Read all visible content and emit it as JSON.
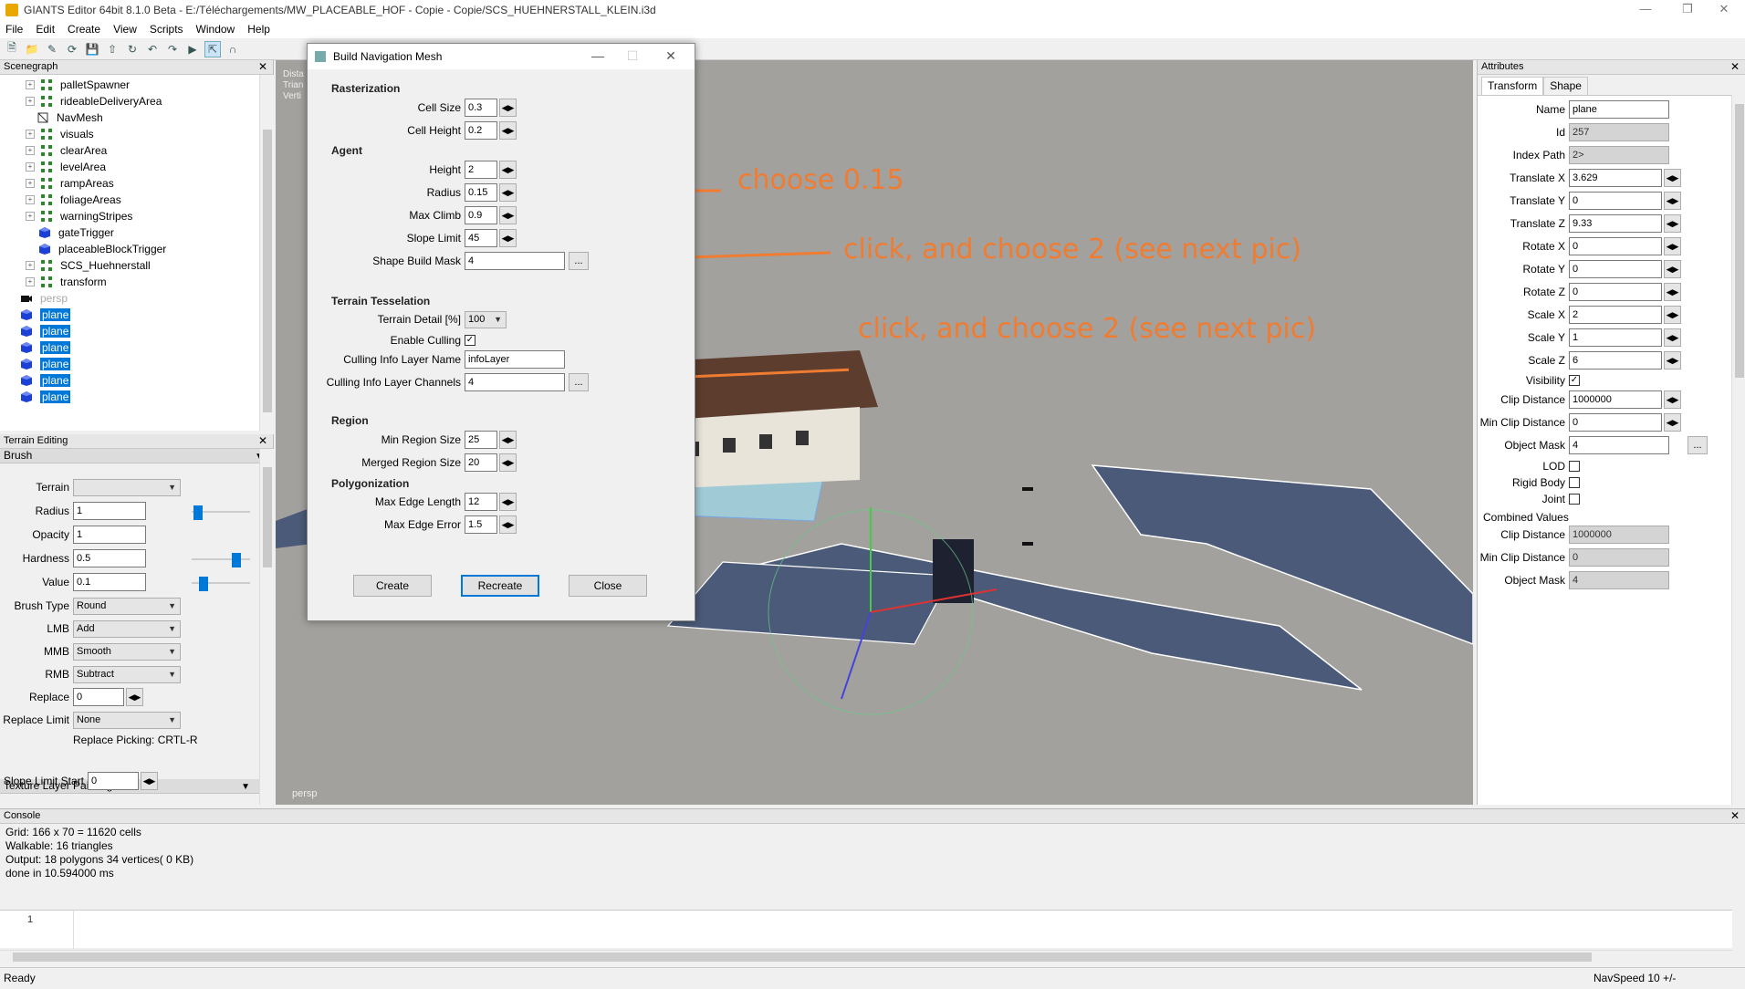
{
  "window": {
    "title": "GIANTS Editor 64bit 8.1.0 Beta - E:/Téléchargements/MW_PLACEABLE_HOF - Copie - Copie/SCS_HUEHNERSTALL_KLEIN.i3d"
  },
  "menu": [
    "File",
    "Edit",
    "Create",
    "View",
    "Scripts",
    "Window",
    "Help"
  ],
  "scenegraph": {
    "title": "Scenegraph",
    "nodes": [
      {
        "label": "palletSpawner",
        "kind": "group"
      },
      {
        "label": "rideableDeliveryArea",
        "kind": "group"
      },
      {
        "label": "NavMesh",
        "kind": "navmesh"
      },
      {
        "label": "visuals",
        "kind": "group"
      },
      {
        "label": "clearArea",
        "kind": "group"
      },
      {
        "label": "levelArea",
        "kind": "group"
      },
      {
        "label": "rampAreas",
        "kind": "group"
      },
      {
        "label": "foliageAreas",
        "kind": "group"
      },
      {
        "label": "warningStripes",
        "kind": "group"
      },
      {
        "label": "gateTrigger",
        "kind": "cube"
      },
      {
        "label": "placeableBlockTrigger",
        "kind": "cube"
      },
      {
        "label": "SCS_Huehnerstall",
        "kind": "group"
      },
      {
        "label": "transform",
        "kind": "group"
      },
      {
        "label": "persp",
        "kind": "camera"
      },
      {
        "label": "plane",
        "kind": "cube"
      },
      {
        "label": "plane",
        "kind": "cube"
      },
      {
        "label": "plane",
        "kind": "cube"
      },
      {
        "label": "plane",
        "kind": "cube"
      },
      {
        "label": "plane",
        "kind": "cube"
      },
      {
        "label": "plane",
        "kind": "cube"
      }
    ]
  },
  "terrain_editing": {
    "title": "Terrain Editing",
    "brush_section": "Brush",
    "terrain_label": "Terrain",
    "terrain_value": "",
    "radius_label": "Radius",
    "radius_value": "1",
    "opacity_label": "Opacity",
    "opacity_value": "1",
    "hardness_label": "Hardness",
    "hardness_value": "0.5",
    "value_label": "Value",
    "value_value": "0.1",
    "brush_type_label": "Brush Type",
    "brush_type_value": "Round",
    "lmb_label": "LMB",
    "lmb_value": "Add",
    "mmb_label": "MMB",
    "mmb_value": "Smooth",
    "rmb_label": "RMB",
    "rmb_value": "Subtract",
    "replace_label": "Replace",
    "replace_value": "0",
    "replace_limit_label": "Replace Limit",
    "replace_limit_value": "None",
    "replace_picking": "Replace Picking: CRTL-R",
    "texture_section": "Texture Layer Painting",
    "slope_limit_start_label": "Slope Limit Start",
    "slope_limit_start_value": "0"
  },
  "viewport": {
    "overlay_lines": [
      "Dista",
      "Trian",
      "Verti"
    ],
    "camera_label": "persp"
  },
  "dialog": {
    "title": "Build Navigation Mesh",
    "rasterization": "Rasterization",
    "cell_size_label": "Cell Size",
    "cell_size": "0.3",
    "cell_height_label": "Cell Height",
    "cell_height": "0.2",
    "agent": "Agent",
    "height_label": "Height",
    "height": "2",
    "radius_label": "Radius",
    "radius": "0.15",
    "max_climb_label": "Max Climb",
    "max_climb": "0.9",
    "slope_limit_label": "Slope Limit",
    "slope_limit": "45",
    "shape_build_mask_label": "Shape Build Mask",
    "shape_build_mask": "4",
    "terrain_tesselation": "Terrain Tesselation",
    "terrain_detail_label": "Terrain Detail [%]",
    "terrain_detail": "100",
    "enable_culling_label": "Enable Culling",
    "enable_culling": true,
    "culling_info_layer_name_label": "Culling Info Layer Name",
    "culling_info_layer_name": "infoLayer",
    "culling_info_layer_channels_label": "Culling Info Layer Channels",
    "culling_info_layer_channels": "4",
    "region": "Region",
    "min_region_size_label": "Min Region Size",
    "min_region_size": "25",
    "merged_region_size_label": "Merged Region Size",
    "merged_region_size": "20",
    "polygonization": "Polygonization",
    "max_edge_length_label": "Max Edge Length",
    "max_edge_length": "12",
    "max_edge_error_label": "Max Edge Error",
    "max_edge_error": "1.5",
    "create_btn": "Create",
    "recreate_btn": "Recreate",
    "close_btn": "Close"
  },
  "annotations": {
    "a1": "choose 0.15",
    "a2": "click, and choose 2 (see next pic)",
    "a3": "click, and choose 2 (see next pic)",
    "color": "#f07c31"
  },
  "attributes": {
    "title": "Attributes",
    "tabs": [
      "Transform",
      "Shape"
    ],
    "name_label": "Name",
    "name": "plane",
    "id_label": "Id",
    "id": "257",
    "index_path_label": "Index Path",
    "index_path": "2>",
    "tx_label": "Translate X",
    "tx": "3.629",
    "ty_label": "Translate Y",
    "ty": "0",
    "tz_label": "Translate Z",
    "tz": "9.33",
    "rx_label": "Rotate X",
    "rx": "0",
    "ry_label": "Rotate Y",
    "ry": "0",
    "rz_label": "Rotate Z",
    "rz": "0",
    "sx_label": "Scale X",
    "sx": "2",
    "sy_label": "Scale Y",
    "sy": "1",
    "sz_label": "Scale Z",
    "sz": "6",
    "visibility_label": "Visibility",
    "visibility": true,
    "clip_label": "Clip Distance",
    "clip": "1000000",
    "min_clip_label": "Min Clip Distance",
    "min_clip": "0",
    "object_mask_label": "Object Mask",
    "object_mask": "4",
    "lod_label": "LOD",
    "lod": false,
    "rigid_body_label": "Rigid Body",
    "rigid_body": false,
    "joint_label": "Joint",
    "joint": false,
    "combined_label": "Combined Values",
    "c_clip_label": "Clip Distance",
    "c_clip": "1000000",
    "c_min_clip_label": "Min Clip Distance",
    "c_min_clip": "0",
    "c_object_mask_label": "Object Mask",
    "c_object_mask": "4"
  },
  "console": {
    "title": "Console",
    "lines": [
      "Grid: 166 x 70 = 11620 cells",
      "Walkable: 16 triangles",
      "Output: 18 polygons 34 vertices( 0 KB)",
      "done in 10.594000 ms"
    ],
    "line_number": "1"
  },
  "status": {
    "left": "Ready",
    "right": "NavSpeed 10 +/-"
  }
}
